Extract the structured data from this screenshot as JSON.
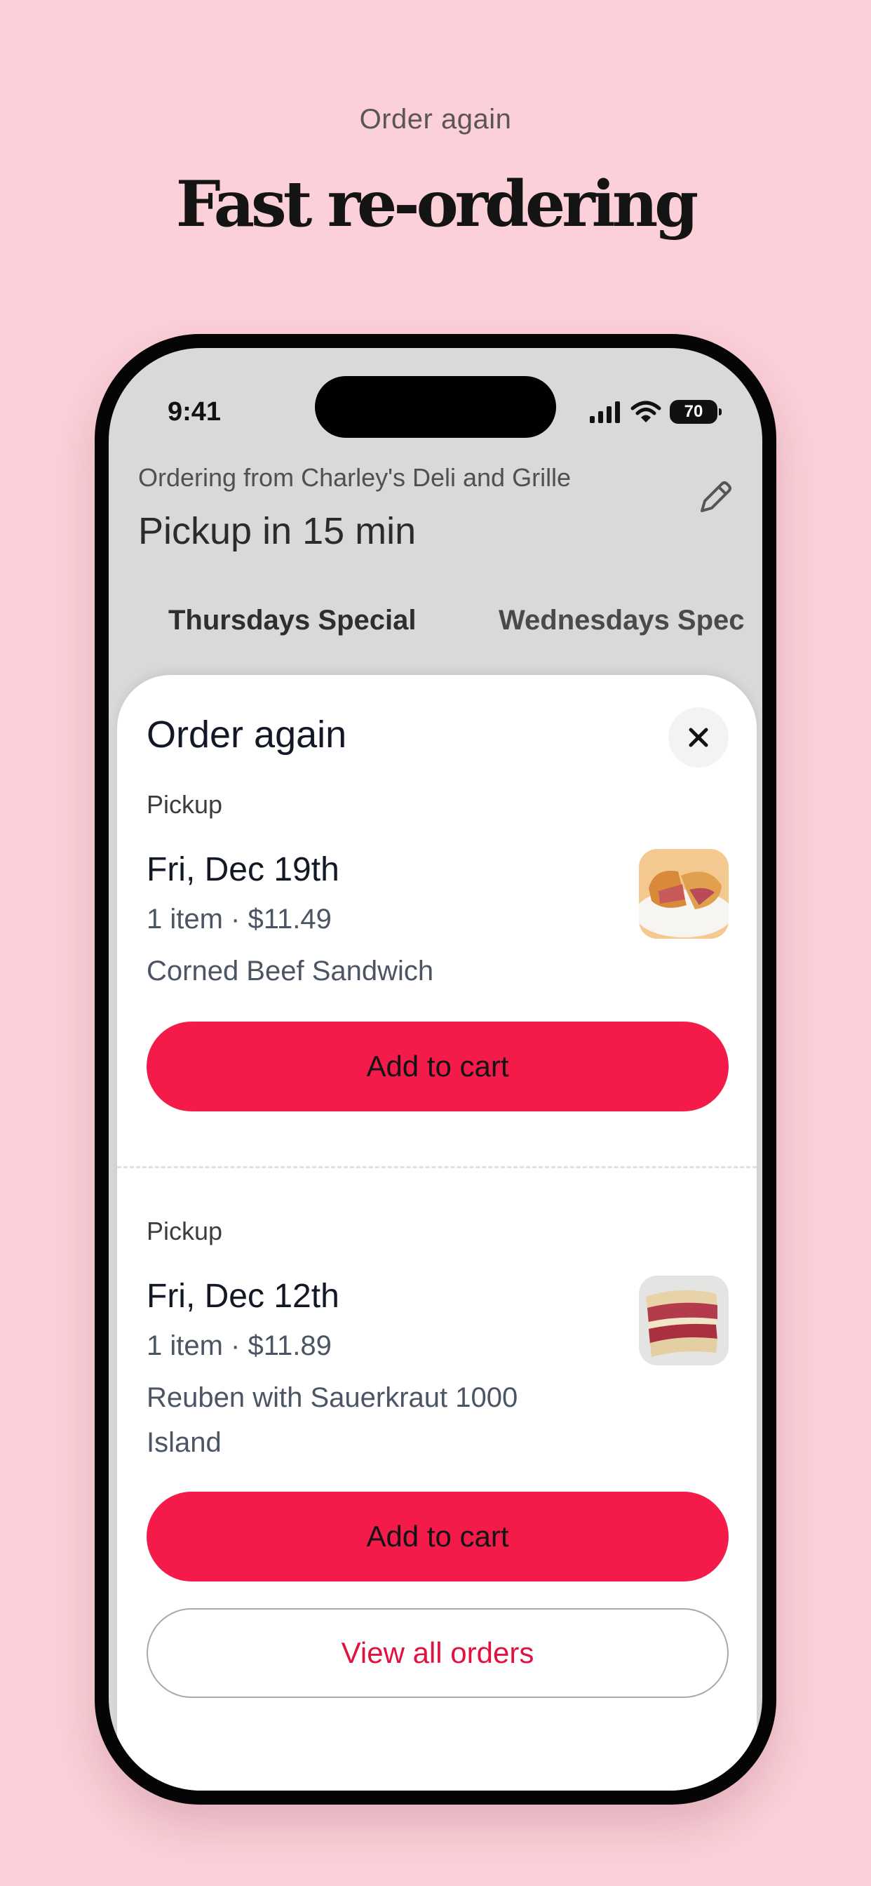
{
  "promo": {
    "kicker": "Order again",
    "title": "Fast re-ordering"
  },
  "status_bar": {
    "time": "9:41",
    "battery": "70",
    "icons": [
      "cellular-signal-icon",
      "wifi-icon",
      "battery-icon"
    ]
  },
  "header": {
    "ordering_from": "Ordering from Charley's Deli and Grille",
    "pickup_time": "Pickup in 15 min",
    "edit_icon": "pencil-icon"
  },
  "tabs": [
    {
      "label": "Thursdays Special"
    },
    {
      "label": "Wednesdays Spec"
    }
  ],
  "sheet": {
    "title": "Order again",
    "close_icon": "close-icon",
    "orders": [
      {
        "mode": "Pickup",
        "date": "Fri, Dec 19th",
        "summary": "1 item · $11.49",
        "items": "Corned Beef Sandwich",
        "button": "Add to cart"
      },
      {
        "mode": "Pickup",
        "date": "Fri, Dec 12th",
        "summary": "1 item · $11.89",
        "items": "Reuben with Sauerkraut 1000 Island",
        "button": "Add to cart"
      }
    ],
    "view_all": "View all orders"
  },
  "colors": {
    "background": "#fbd0d8",
    "accent": "#f41a4a",
    "link": "#e0123f"
  }
}
